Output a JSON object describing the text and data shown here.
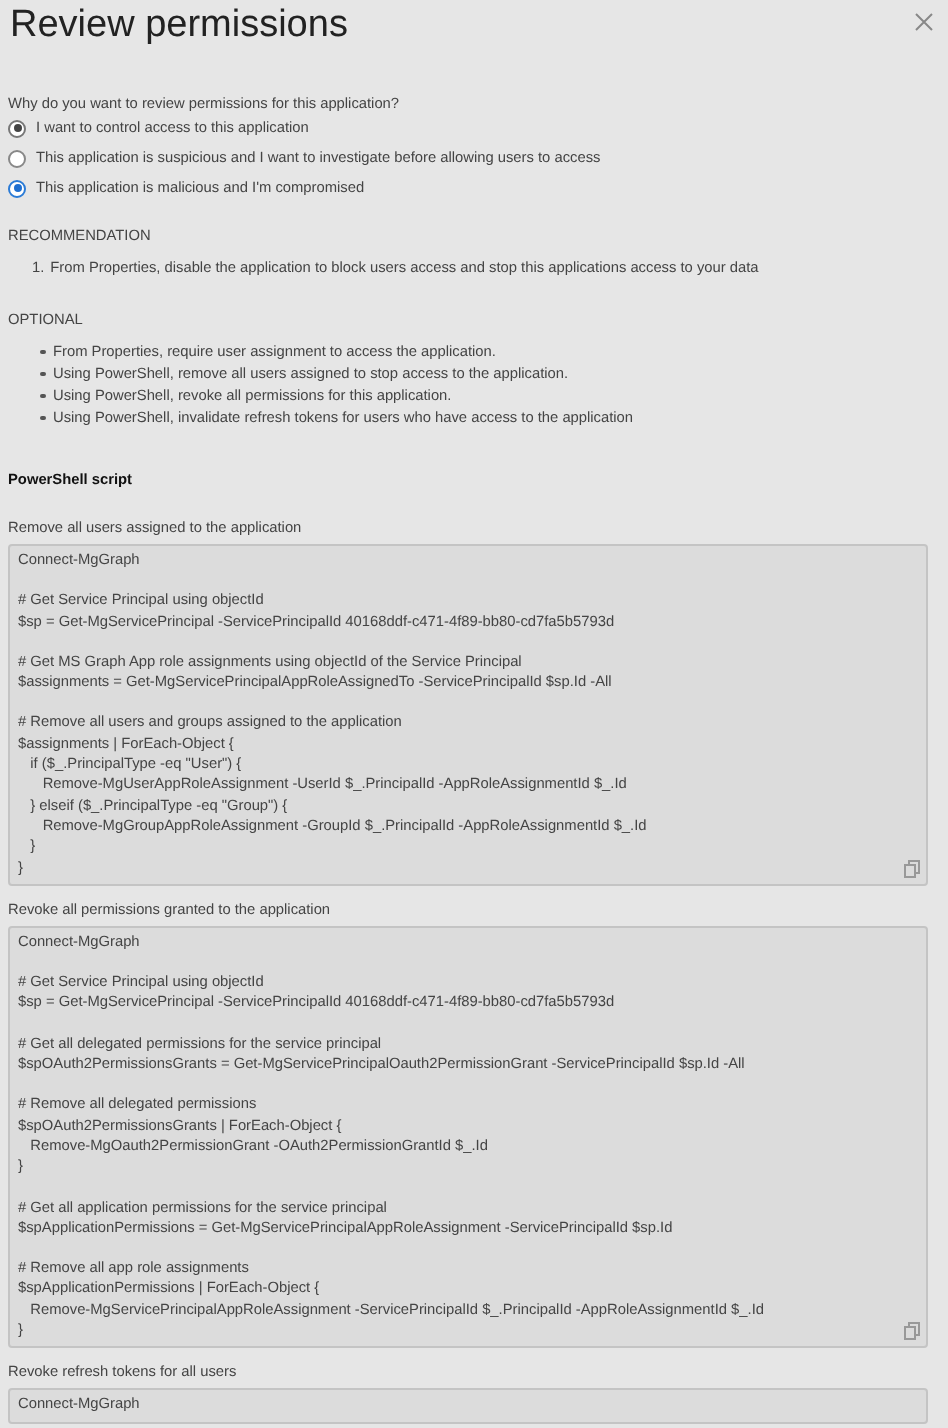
{
  "title": "Review permissions",
  "question": "Why do you want to review permissions for this application?",
  "reasons": [
    {
      "label": "I want to control access to this application",
      "selected": true,
      "disabled": true
    },
    {
      "label": "This application is suspicious and I want to investigate before allowing users to access",
      "selected": false,
      "disabled": false
    },
    {
      "label": "This application is malicious and I'm compromised",
      "selected": true,
      "disabled": false
    }
  ],
  "recommendation": {
    "heading": "RECOMMENDATION",
    "items": [
      {
        "number": "1.",
        "text": "From Properties, disable the application to block users access and stop this applications access to your data"
      }
    ]
  },
  "optional": {
    "heading": "OPTIONAL",
    "items": [
      "From Properties, require user assignment to access the application.",
      "Using PowerShell, remove all users assigned to stop access to the application.",
      "Using PowerShell, revoke all permissions for this application.",
      "Using PowerShell, invalidate refresh tokens for users who have access to the application"
    ]
  },
  "script_heading": "PowerShell script",
  "scripts": [
    {
      "label": "Remove all users assigned to the application",
      "copy_button": true,
      "groups": [
        [
          "Connect-MgGraph"
        ],
        [
          "# Get Service Principal using objectId",
          "$sp = Get-MgServicePrincipal -ServicePrincipalId 40168ddf-c471-4f89-bb80-cd7fa5b5793d"
        ],
        [
          "# Get MS Graph App role assignments using objectId of the Service Principal",
          "$assignments = Get-MgServicePrincipalAppRoleAssignedTo -ServicePrincipalId $sp.Id -All"
        ],
        [
          "# Remove all users and groups assigned to the application",
          "$assignments | ForEach-Object {",
          "   if ($_.PrincipalType -eq \"User\") {",
          "      Remove-MgUserAppRoleAssignment -UserId $_.PrincipalId -AppRoleAssignmentId $_.Id",
          "   } elseif ($_.PrincipalType -eq \"Group\") {",
          "      Remove-MgGroupAppRoleAssignment -GroupId $_.PrincipalId -AppRoleAssignmentId $_.Id",
          "   }",
          "}"
        ]
      ]
    },
    {
      "label": "Revoke all permissions granted to the application",
      "copy_button": true,
      "groups": [
        [
          "Connect-MgGraph"
        ],
        [
          "# Get Service Principal using objectId",
          "$sp = Get-MgServicePrincipal -ServicePrincipalId 40168ddf-c471-4f89-bb80-cd7fa5b5793d"
        ],
        [
          "# Get all delegated permissions for the service principal",
          "$spOAuth2PermissionsGrants = Get-MgServicePrincipalOauth2PermissionGrant -ServicePrincipalId $sp.Id -All"
        ],
        [
          "# Remove all delegated permissions",
          "$spOAuth2PermissionsGrants | ForEach-Object {",
          "   Remove-MgOauth2PermissionGrant -OAuth2PermissionGrantId $_.Id",
          "}"
        ],
        [
          "# Get all application permissions for the service principal",
          "$spApplicationPermissions = Get-MgServicePrincipalAppRoleAssignment -ServicePrincipalId $sp.Id"
        ],
        [
          "# Remove all app role assignments",
          "$spApplicationPermissions | ForEach-Object {",
          "   Remove-MgServicePrincipalAppRoleAssignment -ServicePrincipalId $_.PrincipalId -AppRoleAssignmentId $_.Id",
          "}"
        ]
      ]
    },
    {
      "label": "Revoke refresh tokens for all users",
      "copy_button": false,
      "groups": [
        [
          "Connect-MgGraph"
        ]
      ]
    }
  ]
}
